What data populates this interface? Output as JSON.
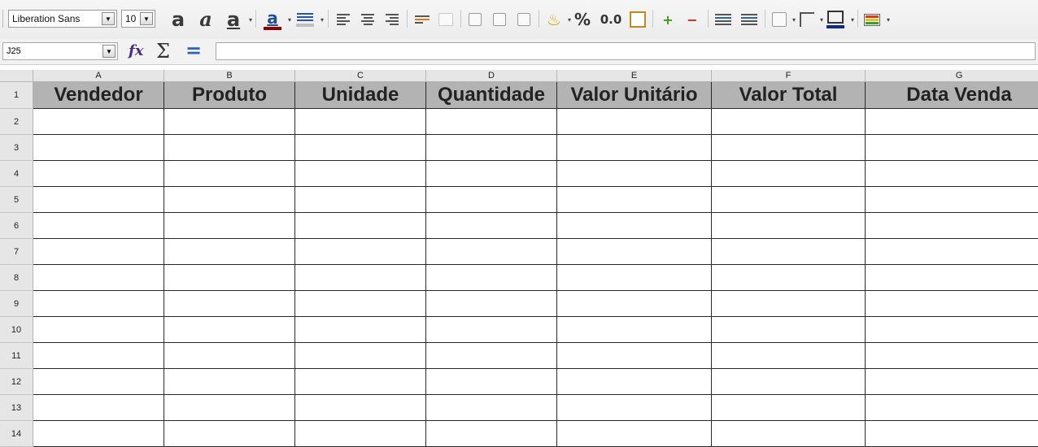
{
  "toolbar": {
    "font_name": "Liberation Sans",
    "font_size": "10",
    "number_format_percent": "%",
    "number_format_decimal": "0.0",
    "icons": [
      "bold-icon",
      "italic-icon",
      "underline-icon",
      "font-color-icon",
      "highlight-icon",
      "align-left-icon",
      "align-center-icon",
      "align-right-icon",
      "wrap-text-icon",
      "merge-cells-icon",
      "align-top-icon",
      "align-middle-icon",
      "align-bottom-icon",
      "currency-icon",
      "date-icon",
      "add-decimal-icon",
      "remove-decimal-icon",
      "increase-indent-icon",
      "decrease-indent-icon",
      "borders-icon",
      "border-style-icon",
      "border-color-icon",
      "conditional-format-icon"
    ],
    "colors": {
      "font_color": "#8b0000",
      "border_color": "#0b2a8c",
      "fx_color": "#4a2c8a",
      "equals_color": "#2a63b8"
    }
  },
  "formula_bar": {
    "cell_reference": "J25",
    "content": ""
  },
  "sheet": {
    "columns": [
      "A",
      "B",
      "C",
      "D",
      "E",
      "F",
      "G"
    ],
    "row_numbers": [
      "1",
      "2",
      "3",
      "4",
      "5",
      "6",
      "7",
      "8",
      "9",
      "10",
      "11",
      "12",
      "13",
      "14"
    ],
    "headers": [
      "Vendedor",
      "Produto",
      "Unidade",
      "Quantidade",
      "Valor Unitário",
      "Valor Total",
      "Data Venda"
    ],
    "header_fill": "#b3b3b3"
  }
}
